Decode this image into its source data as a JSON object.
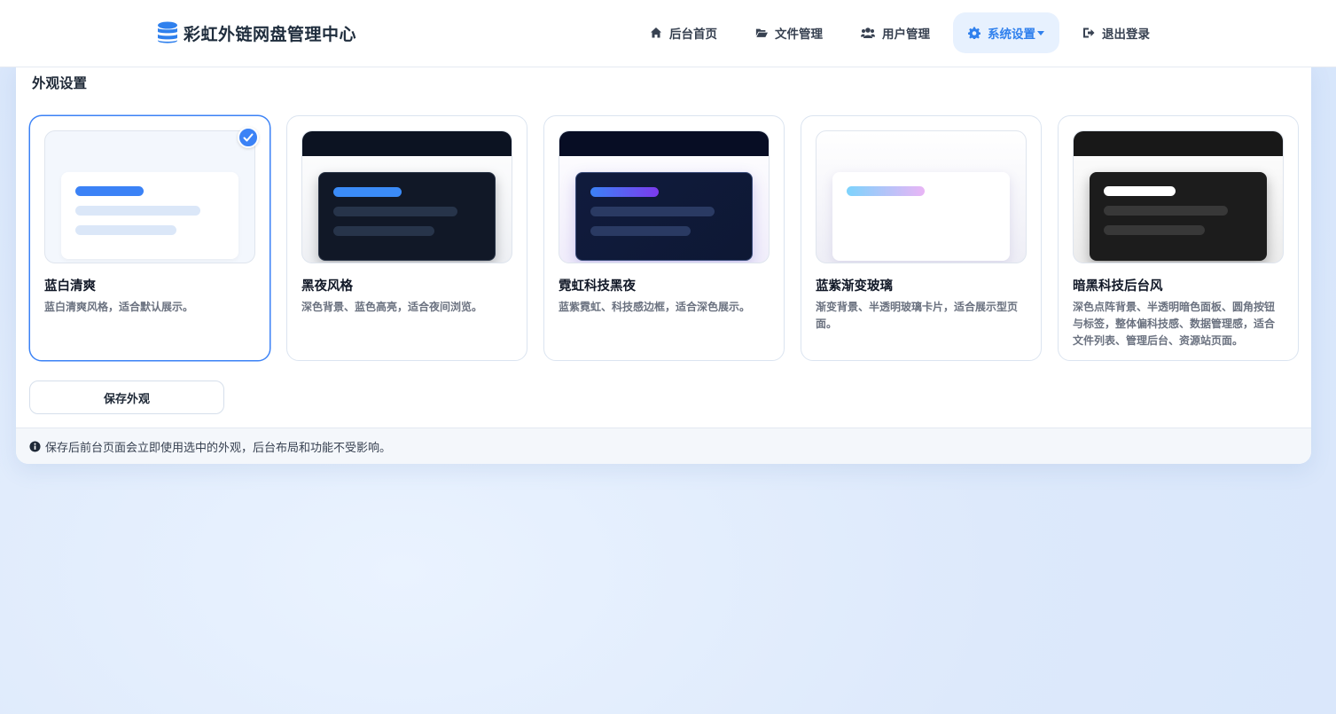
{
  "header": {
    "brand_title": "彩虹外链网盘管理中心",
    "nav": [
      {
        "label": "后台首页",
        "icon": "home-icon"
      },
      {
        "label": "文件管理",
        "icon": "folder-open-icon"
      },
      {
        "label": "用户管理",
        "icon": "users-icon"
      },
      {
        "label": "系统设置",
        "icon": "gear-icon",
        "active": true
      },
      {
        "label": "退出登录",
        "icon": "sign-out-icon"
      }
    ]
  },
  "panel": {
    "title": "外观设置",
    "themes": [
      {
        "name": "蓝白清爽",
        "desc": "蓝白清爽风格，适合默认展示。",
        "selected": true
      },
      {
        "name": "黑夜风格",
        "desc": "深色背景、蓝色高亮，适合夜间浏览。"
      },
      {
        "name": "霓虹科技黑夜",
        "desc": "蓝紫霓虹、科技感边框，适合深色展示。"
      },
      {
        "name": "蓝紫渐变玻璃",
        "desc": "渐变背景、半透明玻璃卡片，适合展示型页面。"
      },
      {
        "name": "暗黑科技后台风",
        "desc": "深色点阵背景、半透明暗色面板、圆角按钮与标签，整体偏科技感、数据管理感，适合文件列表、管理后台、资源站页面。"
      }
    ],
    "save_label": "保存外观",
    "footer_note": "保存后前台页面会立即使用选中的外观，后台布局和功能不受影响。"
  },
  "colors": {
    "accent": "#3b82f6",
    "active_nav_bg": "#e7f1fe"
  }
}
